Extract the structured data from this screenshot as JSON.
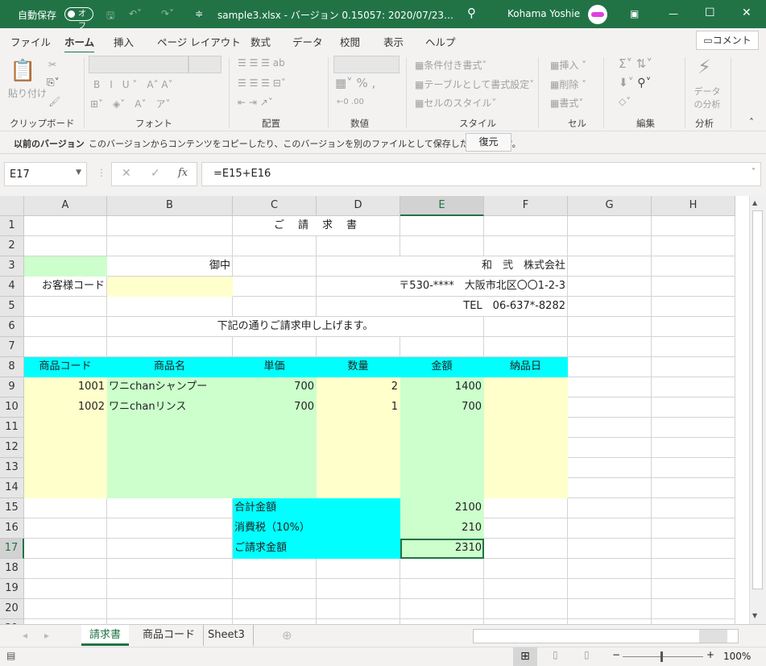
{
  "titlebar": {
    "autosave": "自動保存",
    "autosave_state": "オフ",
    "title": "sample3.xlsx  -  バージョン 0.15057: 2020/07/23…",
    "user": "Kohama Yoshie"
  },
  "tabs": [
    "ファイル",
    "ホーム",
    "挿入",
    "ページ レイアウト",
    "数式",
    "データ",
    "校閲",
    "表示",
    "ヘルプ"
  ],
  "comment_button": "コメント",
  "ribbon": {
    "groups": [
      "クリップボード",
      "フォント",
      "配置",
      "数値",
      "スタイル",
      "セル",
      "編集",
      "分析"
    ],
    "paste": "貼り付け",
    "styles": [
      "条件付き書式",
      "テーブルとして書式設定",
      "セルのスタイル"
    ],
    "cells": [
      "挿入",
      "削除",
      "書式"
    ],
    "analyze": "データの分析"
  },
  "infobar": {
    "title": "以前のバージョン",
    "message": "このバージョンからコンテンツをコピーしたり、このバージョンを別のファイルとして保存したりできます。",
    "restore": "復元"
  },
  "formula_bar": {
    "name_box": "E17",
    "formula": "=E15+E16",
    "fx": "fx"
  },
  "columns": [
    "A",
    "B",
    "C",
    "D",
    "E",
    "F",
    "G",
    "H"
  ],
  "sheet": {
    "rows": {
      "1": {
        "C": "ご　請　求　書"
      },
      "3": {
        "B": "御中",
        "D": "和　弐　株式会社"
      },
      "4": {
        "A": "お客様コード",
        "D": "〒530-****　大阪市北区〇〇1-2-3"
      },
      "5": {
        "D": "TEL　06-637*-8282"
      },
      "6": {
        "B": "下記の通りご請求申し上げます。"
      },
      "8": {
        "A": "商品コード",
        "B": "商品名",
        "C": "単価",
        "D": "数量",
        "E": "金額",
        "F": "納品日"
      },
      "9": {
        "A": "1001",
        "B": "ワニchanシャンプー",
        "C": "700",
        "D": "2",
        "E": "1400"
      },
      "10": {
        "A": "1002",
        "B": "ワニchanリンス",
        "C": "700",
        "D": "1",
        "E": "700"
      },
      "15": {
        "C": "合計金額",
        "E": "2100"
      },
      "16": {
        "C": "消費税（10%）",
        "E": "210"
      },
      "17": {
        "C": "ご請求金額",
        "E": "2310"
      }
    }
  },
  "sheet_tabs": [
    "請求書",
    "商品コード",
    "Sheet3"
  ],
  "status": {
    "zoom": "100%",
    "zoom_level": 100
  },
  "colors": {
    "excel_green": "#217346",
    "cyan": "#00ffff",
    "light_green": "#ccffcc",
    "light_yellow": "#ffffcc"
  }
}
